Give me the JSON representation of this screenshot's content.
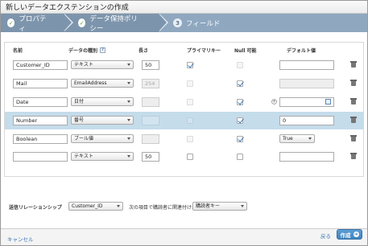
{
  "window": {
    "title": "新しいデータエクステンションの作成"
  },
  "tabs": [
    {
      "label": "プロパティ",
      "state": "done",
      "badge": "✓"
    },
    {
      "label": "データ保持ポリシー",
      "state": "done",
      "badge": "✓"
    },
    {
      "label": "フィールド",
      "state": "active",
      "badge": "3"
    }
  ],
  "table": {
    "headers": {
      "name": "名前",
      "type": "データの種別",
      "length": "長さ",
      "primary_key": "プライマリキー",
      "nullable": "Null 可能",
      "default": "デフォルト値"
    },
    "rows": [
      {
        "name": "Customer_ID",
        "type": "テキスト",
        "length": "50",
        "length_disabled": false,
        "primary_key": true,
        "pk_enabled": true,
        "nullable": false,
        "nullable_enabled": false,
        "default": "",
        "default_disabled": false,
        "default_control": "text"
      },
      {
        "name": "Mail",
        "type": "EmailAddress",
        "length": "254",
        "length_disabled": true,
        "primary_key": false,
        "pk_enabled": false,
        "nullable": true,
        "nullable_enabled": true,
        "default": "",
        "default_disabled": true,
        "default_control": "text"
      },
      {
        "name": "Date",
        "type": "日付",
        "length": "",
        "length_disabled": true,
        "primary_key": false,
        "pk_enabled": false,
        "nullable": true,
        "nullable_enabled": true,
        "default": "",
        "default_disabled": false,
        "default_control": "date"
      },
      {
        "name": "Number",
        "type": "番号",
        "length": "",
        "length_disabled": true,
        "primary_key": false,
        "pk_enabled": false,
        "nullable": true,
        "nullable_enabled": true,
        "default": "0",
        "default_disabled": false,
        "default_control": "text",
        "selected": true
      },
      {
        "name": "Boolean",
        "type": "ブール値",
        "length": "",
        "length_disabled": true,
        "primary_key": false,
        "pk_enabled": false,
        "nullable": true,
        "nullable_enabled": true,
        "default": "True",
        "default_disabled": false,
        "default_control": "select"
      },
      {
        "name": "",
        "type": "テキスト",
        "length": "50",
        "length_disabled": false,
        "primary_key": false,
        "pk_enabled": true,
        "nullable": false,
        "nullable_enabled": true,
        "default": "",
        "default_disabled": false,
        "default_control": "text"
      }
    ]
  },
  "relationship": {
    "label": "送信リレーションシップ",
    "field_value": "Customer_ID",
    "relates_label": "次の項目で購読者に関連付け:",
    "subscriber_value": "購読者キー"
  },
  "footer": {
    "cancel_label": "キャンセル",
    "back_label": "戻る",
    "create_label": "作成",
    "create_icon": "arrow-right-icon"
  },
  "colors": {
    "tab_bar": "#8fa8c0",
    "selected_row": "#c5dcea",
    "primary_button": "#4a8fc8",
    "check_green": "#5aa83b"
  }
}
